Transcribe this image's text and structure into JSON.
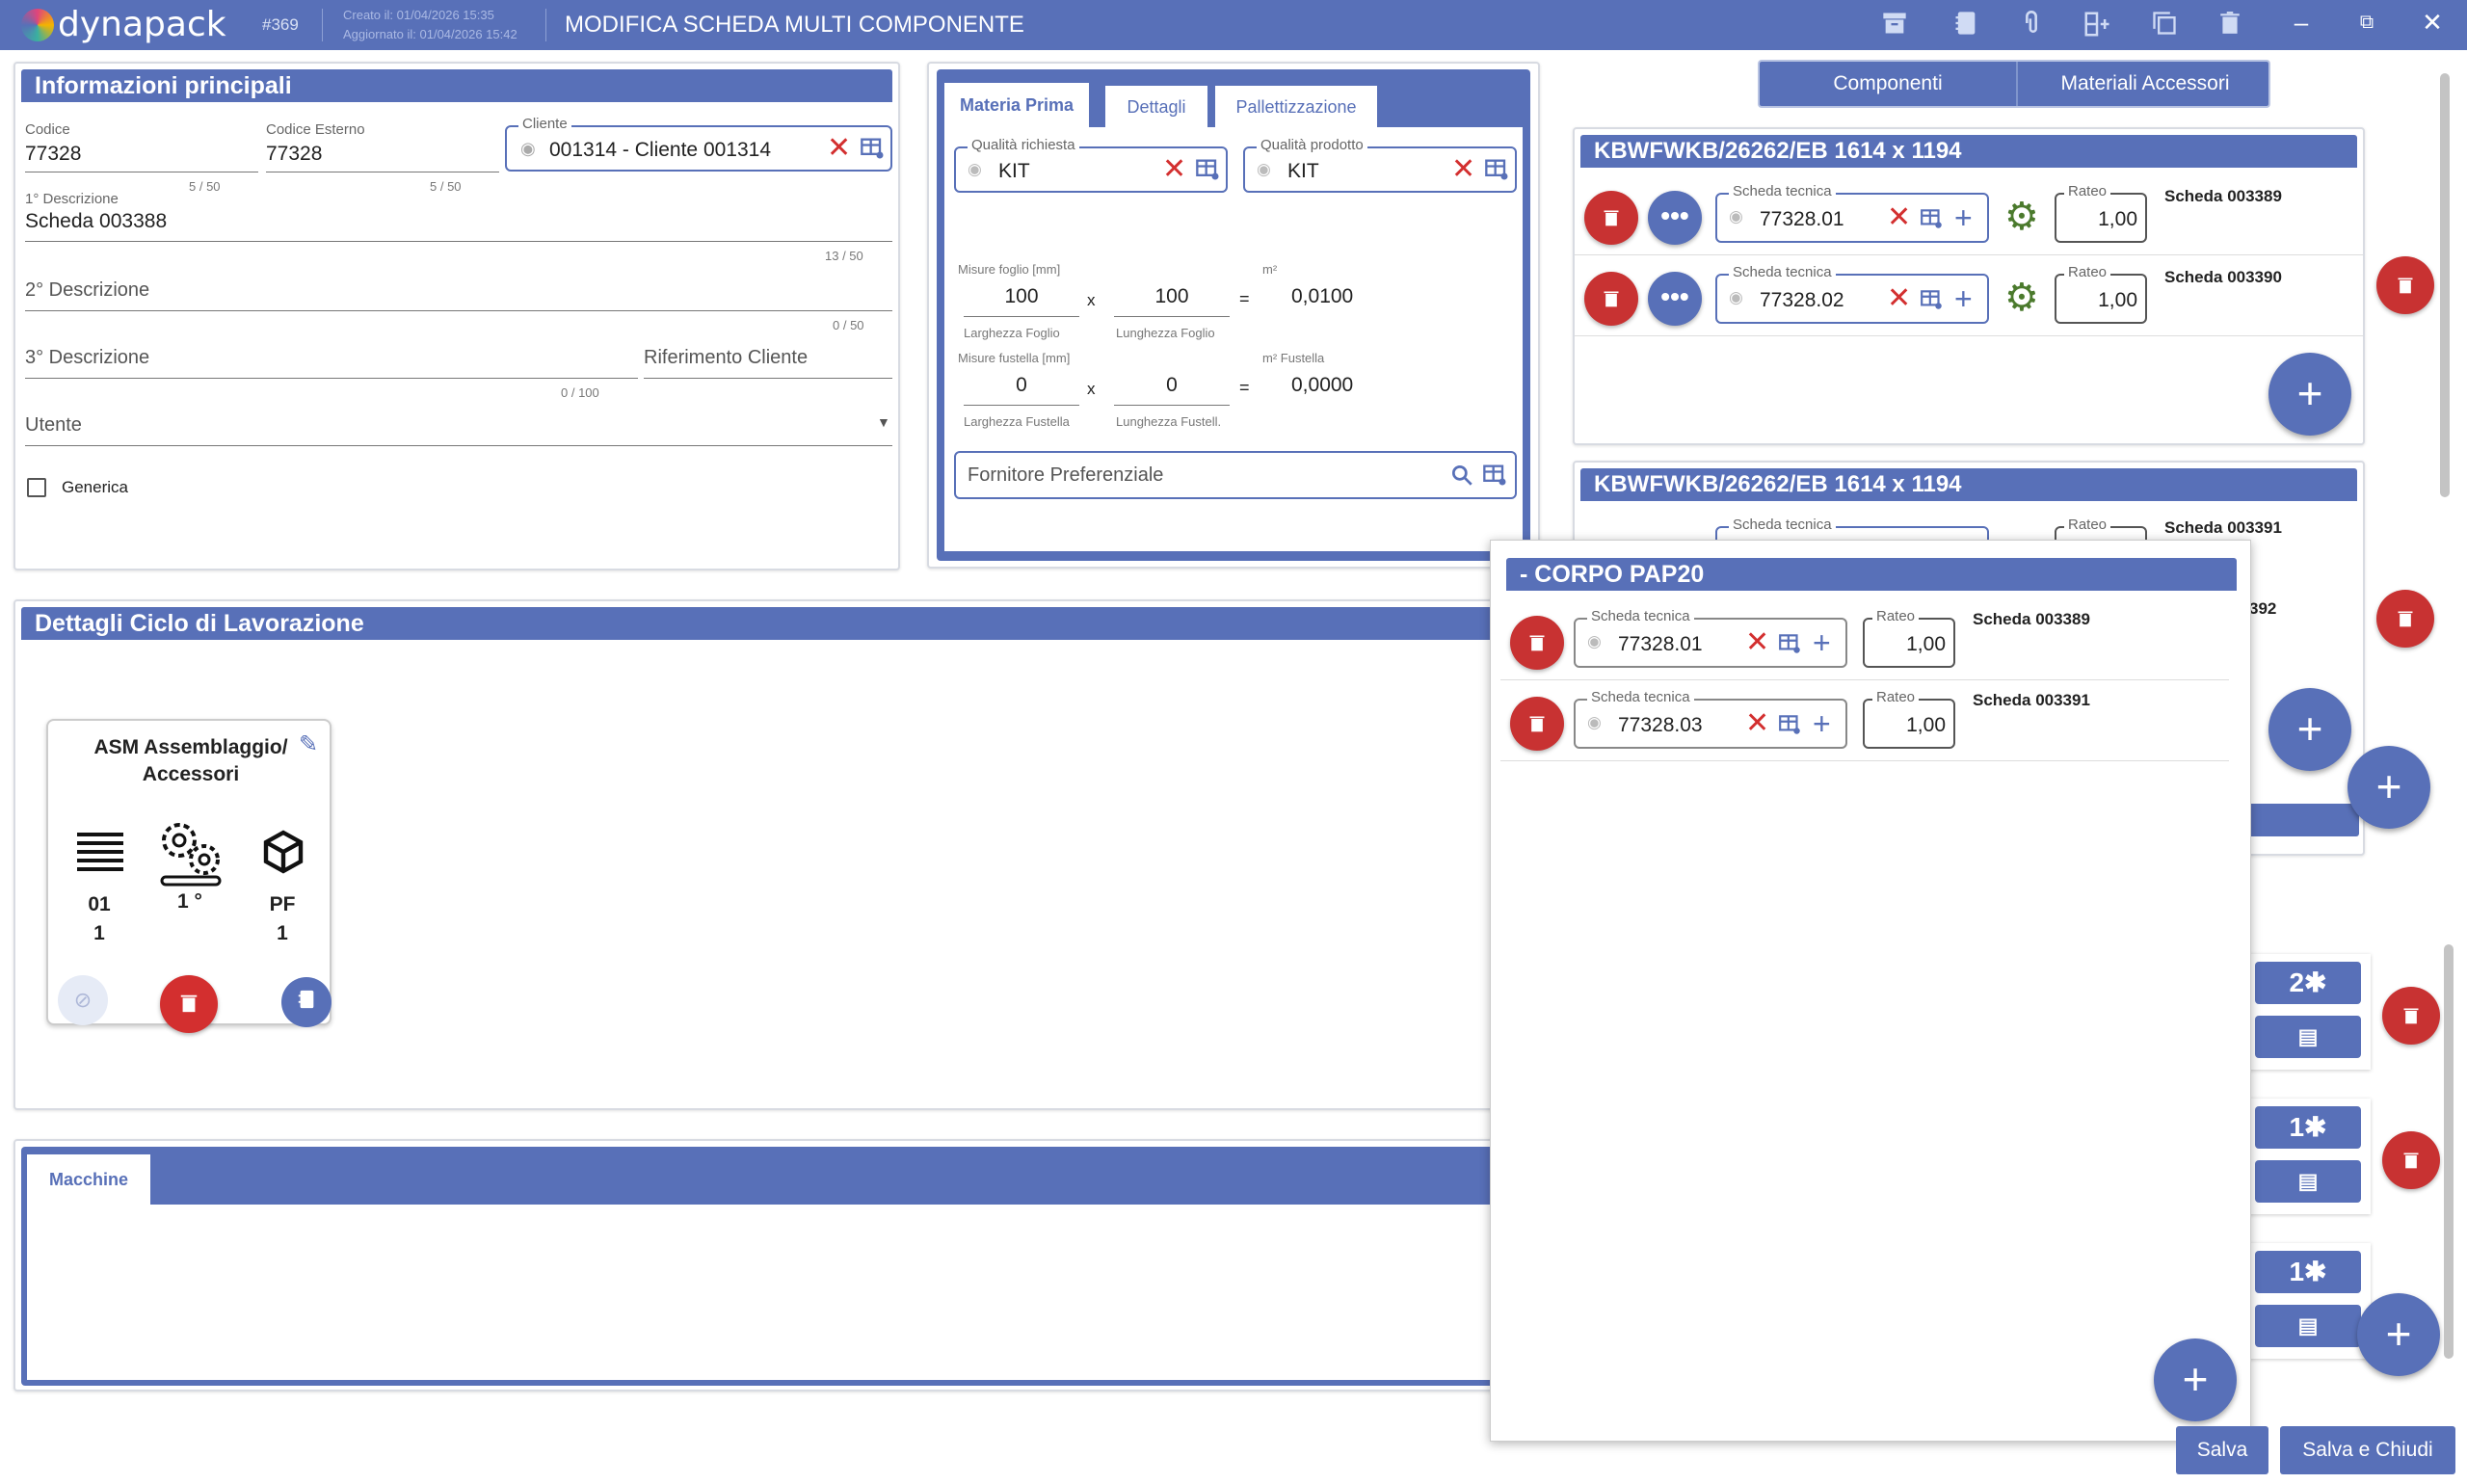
{
  "header": {
    "app_name": "dynapack",
    "record_id": "#369",
    "created": "Creato il: 01/04/2026 15:35",
    "updated": "Aggiornato il: 01/04/2026 15:42",
    "title": "MODIFICA SCHEDA MULTI COMPONENTE",
    "toolbar_icons": [
      "archive-icon",
      "notebook-icon",
      "paperclip-icon",
      "add-row-icon",
      "copy-icon",
      "trash-icon"
    ],
    "window_controls": {
      "minimize": "–",
      "restore": "⧉",
      "close": "✕"
    }
  },
  "main_info": {
    "title": "Informazioni principali",
    "codice": {
      "label": "Codice",
      "value": "77328",
      "counter": "5 / 50"
    },
    "codice_esterno": {
      "label": "Codice Esterno",
      "value": "77328",
      "counter": "5 / 50"
    },
    "cliente": {
      "label": "Cliente",
      "value": "001314 - Cliente 001314"
    },
    "descr1": {
      "label": "1° Descrizione",
      "value": "Scheda 003388",
      "counter": "13 / 50"
    },
    "descr2": {
      "placeholder": "2° Descrizione",
      "counter": "0 / 50"
    },
    "descr3": {
      "placeholder": "3° Descrizione",
      "counter": "0 / 100"
    },
    "rif_cliente": {
      "placeholder": "Riferimento Cliente"
    },
    "utente": {
      "placeholder": "Utente"
    },
    "generica": {
      "label": "Generica",
      "checked": false
    }
  },
  "materia": {
    "tabs": [
      "Materia Prima",
      "Dettagli",
      "Pallettizzazione"
    ],
    "active_tab": "Materia Prima",
    "qualita_richiesta": {
      "label": "Qualità richiesta",
      "value": "KIT"
    },
    "qualita_prodotto": {
      "label": "Qualità prodotto",
      "value": "KIT"
    },
    "misure_foglio": {
      "label": "Misure foglio [mm]",
      "larghezza": "100",
      "lunghezza": "100",
      "m2_label": "m²",
      "m2_value": "0,0100",
      "larghezza_label": "Larghezza Foglio",
      "lunghezza_label": "Lunghezza Foglio"
    },
    "misure_fustella": {
      "label": "Misure fustella [mm]",
      "larghezza": "0",
      "lunghezza": "0",
      "m2_label": "m² Fustella",
      "m2_value": "0,0000",
      "larghezza_label": "Larghezza Fustella",
      "lunghezza_label": "Lunghezza Fustell."
    },
    "times": "x",
    "equals": "=",
    "fornitore": {
      "placeholder": "Fornitore Preferenziale"
    }
  },
  "right_tabs": {
    "componenti": "Componenti",
    "accessori": "Materiali Accessori"
  },
  "componenti": [
    {
      "title": "KBWFWKB/26262/EB 1614 x 1194",
      "rows": [
        {
          "scheda_label": "Scheda tecnica",
          "scheda_value": "77328.01",
          "rateo_label": "Rateo",
          "rateo": "1,00",
          "scheda_name": "Scheda 003389"
        },
        {
          "scheda_label": "Scheda tecnica",
          "scheda_value": "77328.02",
          "rateo_label": "Rateo",
          "rateo": "1,00",
          "scheda_name": "Scheda 003390"
        }
      ]
    },
    {
      "title": "KBWFWKB/26262/EB 1614 x 1194",
      "rows": [
        {
          "scheda_label": "Scheda tecnica",
          "rateo_label": "Rateo",
          "scheda_name": "Scheda 003391"
        },
        {
          "scheda_name_partial": "392"
        }
      ]
    }
  ],
  "accessori_counts": [
    {
      "count": "2"
    },
    {
      "count": "1"
    },
    {
      "count": "1"
    }
  ],
  "ciclo": {
    "title": "Dettagli Ciclo di Lavorazione",
    "card": {
      "title_line1": "ASM Assemblaggio/",
      "title_line2": "Accessori",
      "col1_top": "01",
      "col1_bottom": "1",
      "col2_top": "1 °",
      "col3_top": "PF",
      "col3_bottom": "1"
    }
  },
  "macchine": {
    "tab": "Macchine"
  },
  "popup": {
    "title": "- CORPO PAP20",
    "rows": [
      {
        "scheda_label": "Scheda tecnica",
        "scheda_value": "77328.01",
        "rateo_label": "Rateo",
        "rateo": "1,00",
        "scheda_name": "Scheda 003389"
      },
      {
        "scheda_label": "Scheda tecnica",
        "scheda_value": "77328.03",
        "rateo_label": "Rateo",
        "rateo": "1,00",
        "scheda_name": "Scheda 003391"
      }
    ]
  },
  "footer": {
    "salva": "Salva",
    "salva_chiudi": "Salva e Chiudi"
  },
  "colors": {
    "primary": "#5870b8",
    "danger": "#c83232",
    "gear": "#4b7a2d"
  }
}
